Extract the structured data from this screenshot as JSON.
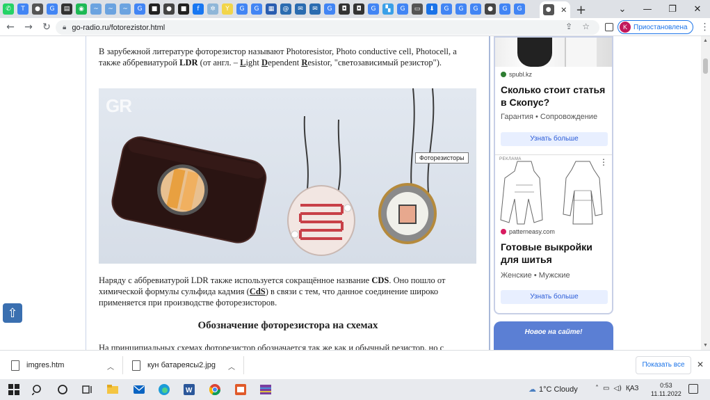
{
  "browser": {
    "active_tab_close": "✕",
    "new_tab": "+",
    "url": "go-radio.ru/fotorezistor.html",
    "profile_initial": "K",
    "profile_status": "Приостановлена",
    "window_controls": {
      "tab_search": "⌄",
      "minimize": "—",
      "maximize": "❐",
      "close": "✕"
    },
    "nav": {
      "back": "←",
      "forward": "→",
      "reload": "↻"
    }
  },
  "article": {
    "para1_pre": "В зарубежной литературе фоторезистор называют Photoresistor, Photo conductive cell, Photocell, а также аббревиатурой ",
    "para1_ldr": "LDR",
    "para1_mid": " (от англ. – ",
    "para1_L": "L",
    "para1_ight": "ight ",
    "para1_D": "D",
    "para1_ependent": "ependent ",
    "para1_R": "R",
    "para1_post": "esistor, \"светозависимый резистор\").",
    "image_watermark": "GR",
    "image_tooltip": "Фоторезисторы",
    "para2_pre": "Наряду с аббревиатурой LDR также используется сокращённое название ",
    "para2_cds": "CDS",
    "para2_mid": ". Оно пошло от химической формулы сульфида кадмия (",
    "para2_cds2": "CdS",
    "para2_post": ") в связи с тем, что данное соединение широко применяется при производстве фоторезисторов.",
    "heading": "Обозначение фоторезистора на схемах",
    "para3": "На принципиальных схемах фоторезистор обозначается так же как и обычный резистор, но с"
  },
  "ads": {
    "ad1": {
      "source": "spubl.kz",
      "title": "Сколько стоит статья в Скопус?",
      "subtitle": "Гарантия • Сопровождение",
      "button": "Узнать больше"
    },
    "ad2": {
      "label": "РЕКЛАМА",
      "source": "patterneasy.com",
      "title": "Готовые выкройки для шитья",
      "subtitle": "Женские • Мужские",
      "button": "Узнать больше"
    },
    "news_header": "Новое на сайте!"
  },
  "downloads": {
    "items": [
      {
        "name": "imgres.htm"
      },
      {
        "name": "кун батареясы2.jpg"
      }
    ],
    "show_all": "Показать все"
  },
  "taskbar": {
    "weather": "1°C  Cloudy",
    "tray_lang": "ҚАЗ",
    "time": "0:53",
    "date": "11.11.2022"
  }
}
